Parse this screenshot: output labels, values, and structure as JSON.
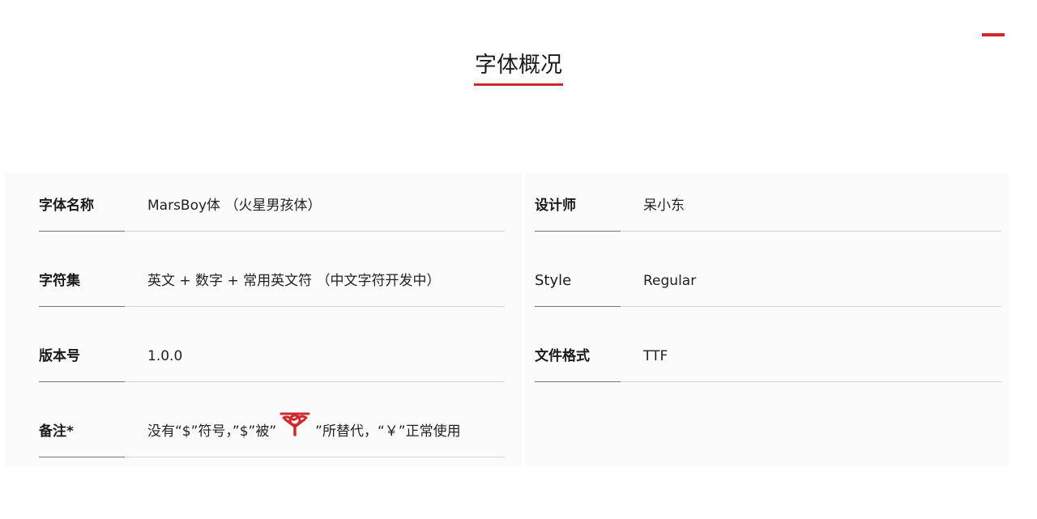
{
  "page": {
    "title": "字体概况",
    "accent_color": "#d0282e"
  },
  "info": {
    "font_name": {
      "label": "字体名称",
      "value": "MarsBoy体 （火星男孩体）"
    },
    "designer": {
      "label": "设计师",
      "value": "呆小东"
    },
    "charset": {
      "label": "字符集",
      "value": "英文 + 数字 + 常用英文符 （中文字符开发中）"
    },
    "style": {
      "label": "Style",
      "value": "Regular"
    },
    "version": {
      "label": "版本号",
      "value": "1.0.0"
    },
    "format": {
      "label": "文件格式",
      "value": "TTF"
    },
    "notes": {
      "label": "备注*",
      "text_before": "没有“$”符号，”$”被”",
      "symbol_icon": "red-replacement-glyph-icon",
      "text_after": "”所替代，“￥”正常使用"
    }
  }
}
